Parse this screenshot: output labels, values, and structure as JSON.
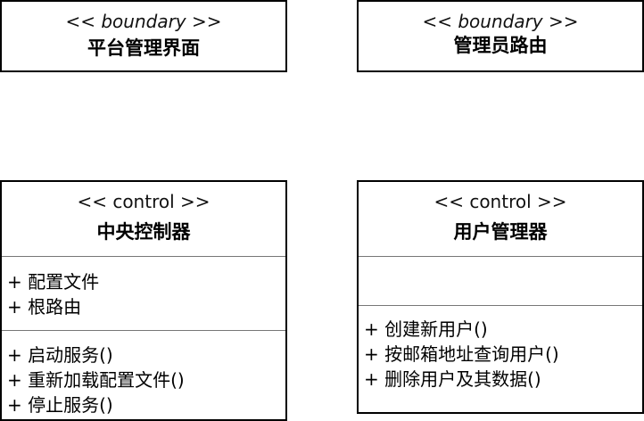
{
  "boxes": {
    "platform_ui": {
      "stereotype": "<< boundary >>",
      "name": "平台管理界面"
    },
    "admin_router": {
      "stereotype": "<< boundary >>",
      "name": "管理员路由"
    },
    "central_controller": {
      "stereotype": "<< control >>",
      "name": "中央控制器",
      "attributes": [
        "+ 配置文件",
        "+ 根路由"
      ],
      "operations": [
        "+ 启动服务()",
        "+ 重新加载配置文件()",
        "+ 停止服务()"
      ]
    },
    "user_manager": {
      "stereotype": "<< control >>",
      "name": "用户管理器",
      "attributes": [],
      "operations": [
        "+ 创建新用户()",
        "+ 按邮箱地址查询用户()",
        "+ 删除用户及其数据()"
      ]
    }
  }
}
